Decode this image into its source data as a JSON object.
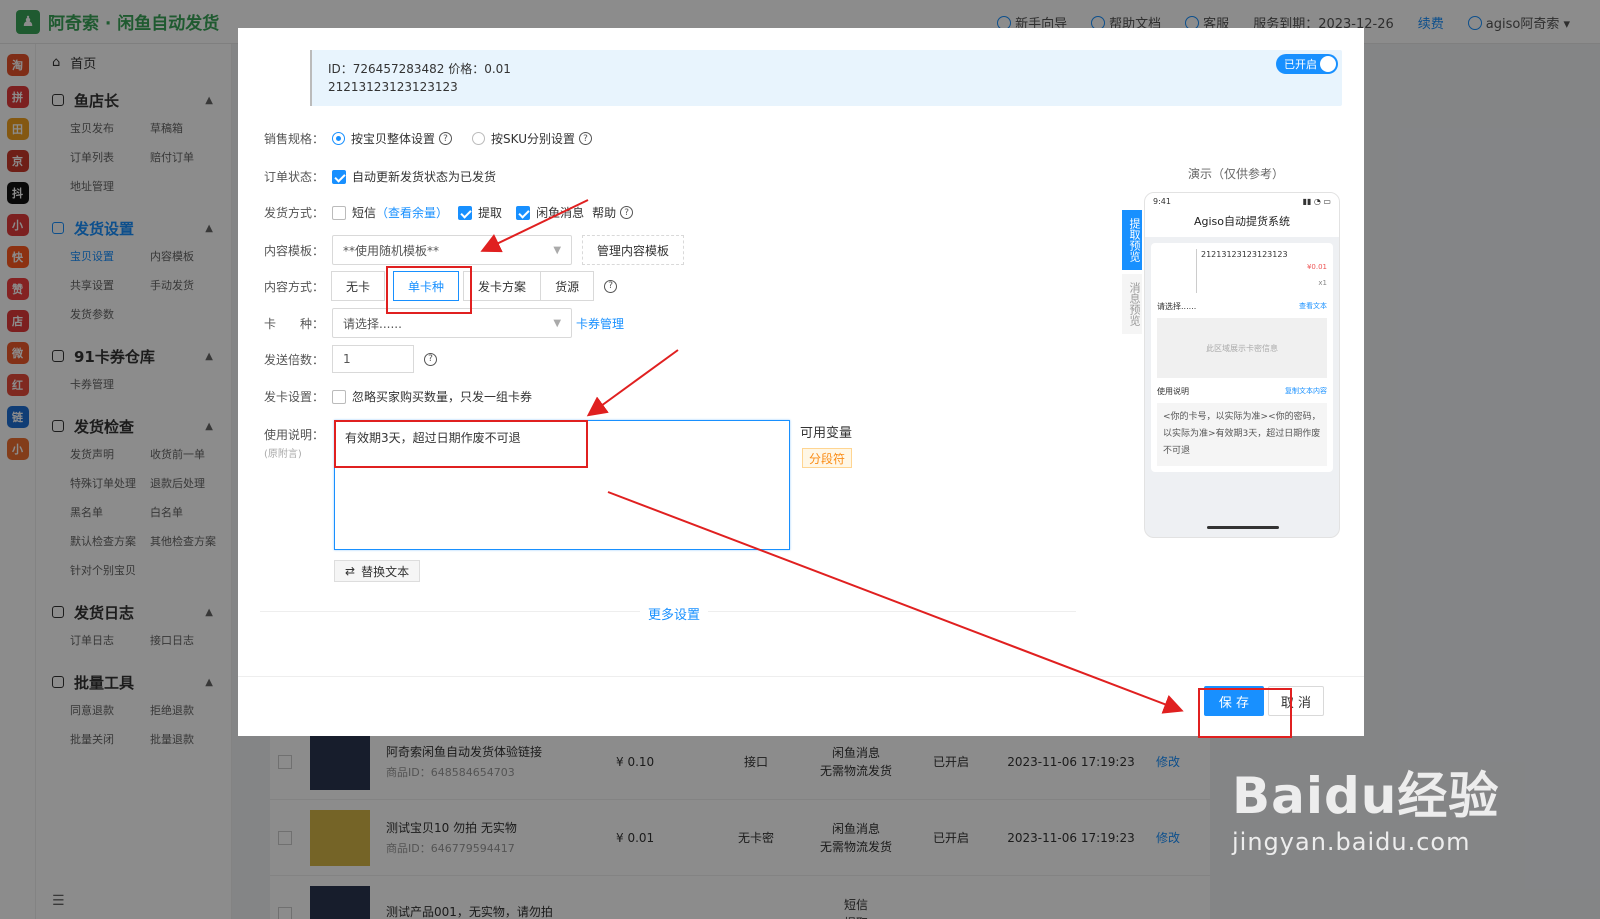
{
  "app": {
    "title": "阿奇索 · 闲鱼自动发货",
    "topnav": {
      "guide": "新手向导",
      "docs": "帮助文档",
      "service": "客服",
      "expire": "服务到期：2023-12-26",
      "renew": "续费",
      "user": "agiso阿奇索"
    }
  },
  "sidebar": {
    "home": "首页",
    "groups": [
      {
        "title": "鱼店长",
        "items": [
          "宝贝发布",
          "草稿箱",
          "订单列表",
          "赔付订单",
          "地址管理"
        ]
      },
      {
        "title": "发货设置",
        "items": [
          "宝贝设置",
          "内容模板",
          "共享设置",
          "手动发货",
          "发货参数"
        ],
        "active_item": "宝贝设置"
      },
      {
        "title": "91卡券仓库",
        "items": [
          "卡券管理"
        ]
      },
      {
        "title": "发货检查",
        "items": [
          "发货声明",
          "收货前一单",
          "特殊订单处理",
          "退款后处理",
          "黑名单",
          "白名单",
          "默认检查方案",
          "其他检查方案",
          "针对个别宝贝"
        ]
      },
      {
        "title": "发货日志",
        "items": [
          "订单日志",
          "接口日志"
        ]
      },
      {
        "title": "批量工具",
        "items": [
          "同意退款",
          "拒绝退款",
          "批量关闭",
          "批量退款"
        ]
      }
    ],
    "app_icons": [
      "淘",
      "拼",
      "田园",
      "京东",
      "抖",
      "小红书",
      "快",
      "赞",
      "店",
      "微",
      "红",
      "链",
      "小"
    ]
  },
  "modal": {
    "product": {
      "id_line": "ID：726457283482    价格：0.01",
      "name": "21213123123123123",
      "toggle": "已开启"
    },
    "spec": {
      "label": "销售规格：",
      "opt1": "按宝贝整体设置",
      "opt2": "按SKU分别设置"
    },
    "order_status": {
      "label": "订单状态：",
      "text": "自动更新发货状态为已发货"
    },
    "ship_method": {
      "label": "发货方式：",
      "sms": "短信",
      "balance": "（查看余量）",
      "pickup": "提取",
      "xianyu": "闲鱼消息",
      "help": "帮助"
    },
    "template": {
      "label": "内容模板：",
      "value": "**使用随机模板**",
      "manage": "管理内容模板"
    },
    "content_mode": {
      "label": "内容方式：",
      "options": [
        "无卡",
        "单卡种",
        "发卡方案",
        "货源"
      ],
      "selected": "单卡种"
    },
    "card_type": {
      "label": "卡　　种：",
      "placeholder": "请选择......",
      "manage": "卡券管理"
    },
    "multiplier": {
      "label": "发送倍数：",
      "value": "1"
    },
    "card_setting": {
      "label": "发卡设置：",
      "text": "忽略买家购买数量，只发一组卡券"
    },
    "usage": {
      "label": "使用说明：",
      "sublabel": "(原附言)",
      "value": "有效期3天，超过日期作废不可退"
    },
    "vars": {
      "title": "可用变量",
      "tag": "分段符"
    },
    "replace": "替换文本",
    "more": "更多设置",
    "save": "保 存",
    "cancel": "取 消",
    "preview": {
      "demo_title": "演示（仅供参考）",
      "tab_pickup": "提取预览",
      "tab_msg": "消息预览",
      "time": "9:41",
      "title": "Agiso自动提货系统",
      "product_name": "21213123123123123",
      "price": "¥0.01",
      "qty": "x1",
      "choose": "请选择......",
      "view_orig": "查看文本",
      "card_area": "此区域展示卡密信息",
      "usage_label": "使用说明",
      "copy": "复制文本内容",
      "usage_text": "<你的卡号，以实际为准><你的密码，以实际为准>有效期3天，超过日期作废不可退"
    }
  },
  "background_rows": [
    {
      "title": "阿奇索闲鱼自动发货体验链接",
      "pid": "商品ID：648584654703",
      "price": "¥ 0.10",
      "mode": "接口",
      "ship1": "闲鱼消息",
      "ship2": "无需物流发货",
      "status": "已开启",
      "time": "2023-11-06 17:19:23",
      "edit": "修改"
    },
    {
      "title": "测试宝贝10 勿拍 无实物",
      "pid": "商品ID：646779594417",
      "price": "¥ 0.01",
      "mode": "无卡密",
      "ship1": "闲鱼消息",
      "ship2": "无需物流发货",
      "status": "已开启",
      "time": "2023-11-06 17:19:23",
      "edit": "修改"
    },
    {
      "title": "测试产品001，无实物，请勿拍",
      "pid": "",
      "price": "",
      "mode": "",
      "ship1": "短信",
      "ship2": "提取",
      "status": "",
      "time": "",
      "edit": ""
    }
  ],
  "watermark": {
    "line1": "Baidu经验",
    "line2": "jingyan.baidu.com"
  }
}
